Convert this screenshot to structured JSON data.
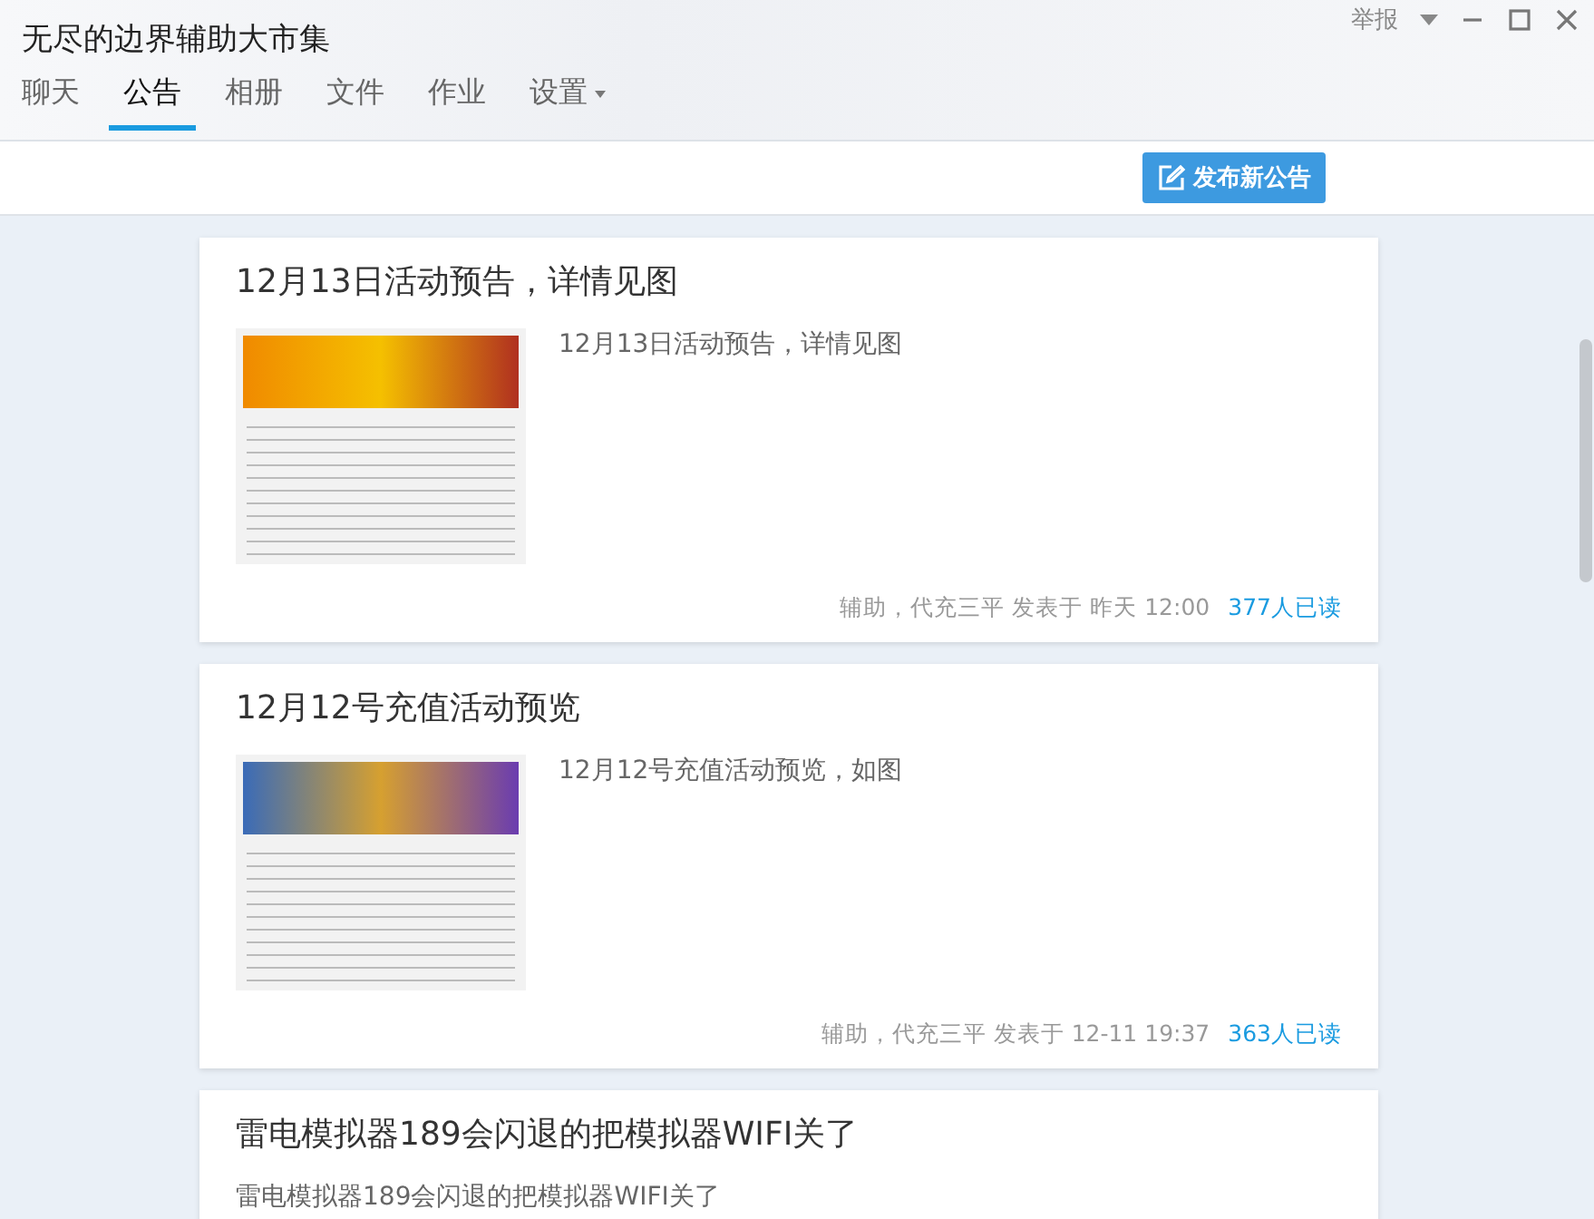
{
  "window": {
    "title": "无尽的边界辅助大市集",
    "report_label": "举报"
  },
  "tabs": [
    {
      "label": "聊天",
      "selected": false,
      "has_menu": false
    },
    {
      "label": "公告",
      "selected": true,
      "has_menu": false
    },
    {
      "label": "相册",
      "selected": false,
      "has_menu": false
    },
    {
      "label": "文件",
      "selected": false,
      "has_menu": false
    },
    {
      "label": "作业",
      "selected": false,
      "has_menu": false
    },
    {
      "label": "设置",
      "selected": false,
      "has_menu": true
    }
  ],
  "toolbar": {
    "new_button": "发布新公告"
  },
  "announcements": [
    {
      "title": "12月13日活动预告，详情见图",
      "has_image": true,
      "summary": "12月13日活动预告，详情见图",
      "author": "辅助，代充三平",
      "posted": "发表于 昨天 12:00",
      "reads": "377人已读"
    },
    {
      "title": "12月12号充值活动预览",
      "has_image": true,
      "summary": "12月12号充值活动预览，如图",
      "author": "辅助，代充三平",
      "posted": "发表于 12-11 19:37",
      "reads": "363人已读"
    },
    {
      "title": "雷电模拟器189会闪退的把模拟器WIFI关了",
      "has_image": false,
      "summary": "雷电模拟器189会闪退的把模拟器WIFI关了"
    }
  ]
}
